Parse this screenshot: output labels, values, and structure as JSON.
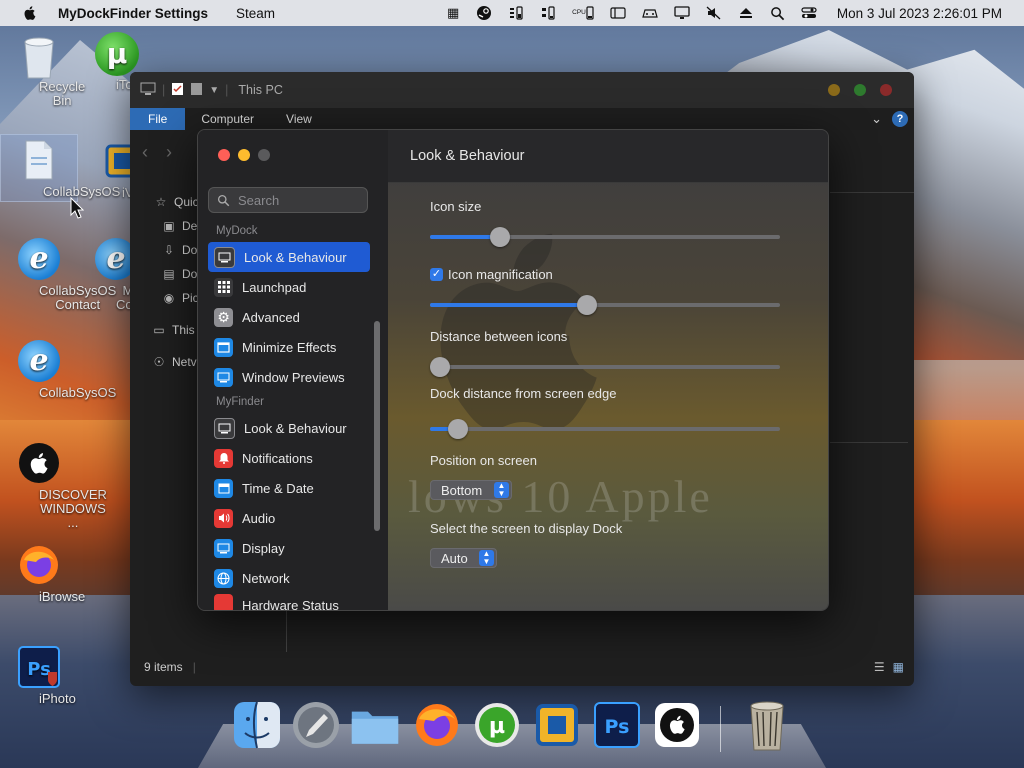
{
  "menubar": {
    "app_name": "MyDockFinder Settings",
    "menu_items": [
      "Steam"
    ],
    "tray_cpu_label": "CPU",
    "clock": "Mon 3 Jul 2023  2:26:01 PM"
  },
  "desktop": {
    "icons": [
      {
        "label": "Recycle Bin",
        "icon": "recycle-bin-icon"
      },
      {
        "label": "iTorre",
        "icon": "utorrent-icon"
      },
      {
        "label": "CollabSysOS",
        "icon": "file-icon"
      },
      {
        "label": "iVirtu",
        "icon": "virtualbox-icon"
      },
      {
        "label": "CollabSysOS Contact",
        "icon": "internet-explorer-icon"
      },
      {
        "label": "MORE CollabSy",
        "icon": "internet-explorer-icon"
      },
      {
        "label": "CollabSysOS",
        "icon": "internet-explorer-icon"
      },
      {
        "label": "DISCOVER WINDOWS ...",
        "icon": "apple-icon"
      },
      {
        "label": "iBrowse",
        "icon": "firefox-icon"
      },
      {
        "label": "iPhoto",
        "icon": "photoshop-icon"
      }
    ]
  },
  "explorer": {
    "title": "This PC",
    "tabs": [
      "File",
      "Computer",
      "View"
    ],
    "help": "?",
    "nav_items": [
      {
        "label": "Quic",
        "icon": "star-icon"
      },
      {
        "label": "De",
        "icon": "desktop-icon"
      },
      {
        "label": "Do",
        "icon": "download-icon"
      },
      {
        "label": "Do",
        "icon": "document-icon"
      },
      {
        "label": "Pic",
        "icon": "camera-icon"
      },
      {
        "label": "This",
        "icon": "monitor-icon"
      },
      {
        "label": "Netv",
        "icon": "network-icon"
      }
    ],
    "status": "9 items"
  },
  "settings": {
    "search_placeholder": "Search",
    "section_mydock": "MyDock",
    "section_myfinder": "MyFinder",
    "mydock_items": [
      {
        "label": "Look & Behaviour",
        "icon": "monitor-icon",
        "color": "#3a3a3c",
        "active": true
      },
      {
        "label": "Launchpad",
        "icon": "grid-icon",
        "color": "#3a3a3c"
      },
      {
        "label": "Advanced",
        "icon": "gear-icon",
        "color": "#8e8e93"
      },
      {
        "label": "Minimize Effects",
        "icon": "window-icon",
        "color": "#1e88e5"
      },
      {
        "label": "Window Previews",
        "icon": "monitor-icon",
        "color": "#1e88e5"
      }
    ],
    "myfinder_items": [
      {
        "label": "Look & Behaviour",
        "icon": "monitor-icon",
        "color": "#3a3a3c"
      },
      {
        "label": "Notifications",
        "icon": "bell-icon",
        "color": "#e53935"
      },
      {
        "label": "Time & Date",
        "icon": "calendar-icon",
        "color": "#1e88e5"
      },
      {
        "label": "Audio",
        "icon": "speaker-icon",
        "color": "#e53935"
      },
      {
        "label": "Display",
        "icon": "display-icon",
        "color": "#1e88e5"
      },
      {
        "label": "Network",
        "icon": "globe-icon",
        "color": "#1e88e5"
      },
      {
        "label": "Hardware Status",
        "icon": "chip-icon",
        "color": "#e53935"
      }
    ],
    "header_title": "Look & Behaviour",
    "icon_size_label": "Icon size",
    "icon_size_value": 0.17,
    "icon_magnification_label": "Icon magnification",
    "icon_magnification_checked": true,
    "icon_magnification_value": 0.42,
    "distance_icons_label": "Distance between icons",
    "distance_icons_value": 0.0,
    "dock_distance_label": "Dock distance from screen edge",
    "dock_distance_value": 0.05,
    "position_label": "Position on screen",
    "position_value": "Bottom",
    "screen_label": "Select the screen to display Dock",
    "screen_value": "Auto",
    "background_text": "lows 10 Apple"
  },
  "dock": {
    "items": [
      "finder-icon",
      "launchpad-icon",
      "folder-icon",
      "firefox-icon",
      "utorrent-icon",
      "virtualbox-icon",
      "photoshop-icon",
      "apple-icon",
      "trash-icon"
    ]
  },
  "colors": {
    "accent": "#2f79e8",
    "sidebar_active": "#1f5bd3",
    "close": "#ff5f57",
    "minimize": "#febc2e",
    "zoom": "#28c840"
  }
}
